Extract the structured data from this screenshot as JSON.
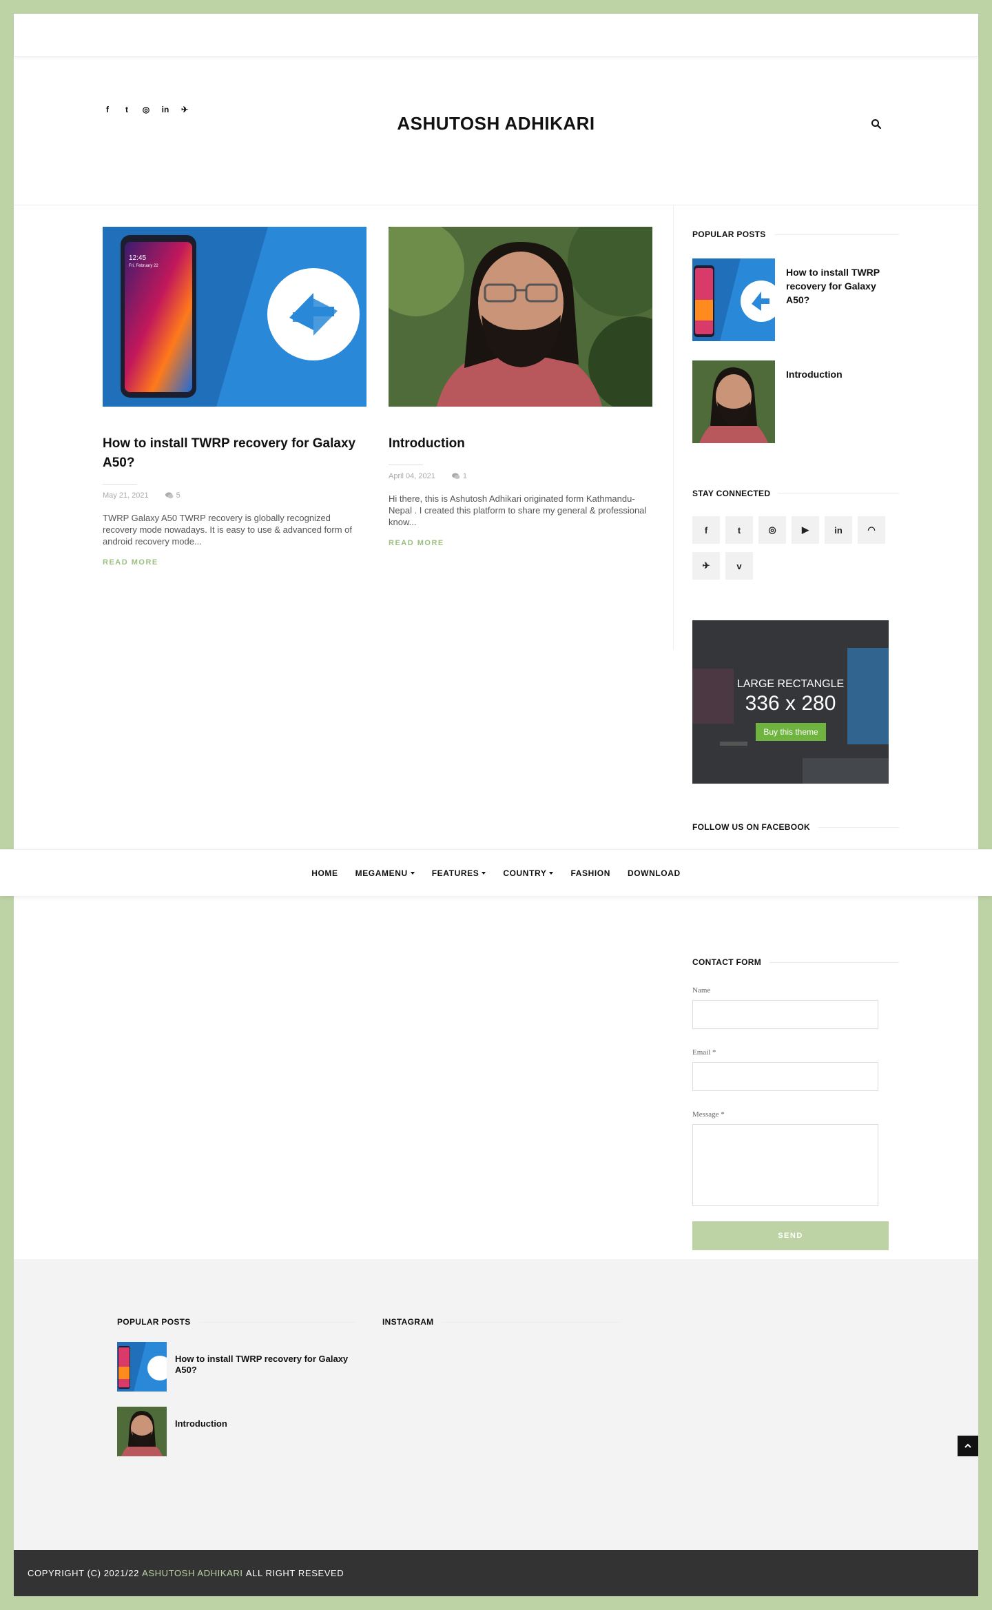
{
  "site": {
    "title": "ASHUTOSH ADHIKARI"
  },
  "header": {
    "social_icons": [
      "facebook-icon",
      "twitter-icon",
      "instagram-icon",
      "linkedin-icon",
      "telegram-icon"
    ],
    "social_glyphs": [
      "f",
      "t",
      "◎",
      "in",
      "✈"
    ]
  },
  "posts": [
    {
      "title": "How to install TWRP recovery for Galaxy A50?",
      "date": "May 21, 2021",
      "comments": "5",
      "excerpt": " TWRP Galaxy A50 TWRP recovery is globally recognized recovery mode nowadays. It is easy to use & advanced form of android recovery mode...",
      "read_more": "READ MORE",
      "image": "twrp-galaxy-a50-image",
      "phone_time": "12:45",
      "phone_date": "Fri, February 22"
    },
    {
      "title": "Introduction",
      "date": "April 04, 2021",
      "comments": "1",
      "excerpt": "  Hi there, this is Ashutosh Adhikari originated form Kathmandu-Nepal . I created this platform to share my general & professional know...",
      "read_more": "READ MORE",
      "image": "author-portrait-image"
    }
  ],
  "sidebar": {
    "popular_title": "POPULAR POSTS",
    "popular": [
      "How to install TWRP recovery for Galaxy A50?",
      "Introduction"
    ],
    "stay_connected_title": "STAY CONNECTED",
    "stay_icons": [
      "facebook-icon",
      "twitter-icon",
      "instagram-icon",
      "youtube-icon",
      "linkedin-icon",
      "rss-icon",
      "telegram-icon",
      "vimeo-icon"
    ],
    "stay_glyphs": [
      "f",
      "t",
      "◎",
      "▶",
      "in",
      "◠",
      "✈",
      "v"
    ],
    "ad": {
      "line1": "LARGE RECTANGLE",
      "line2": "336 x 280",
      "button": "Buy this theme"
    },
    "facebook_title": "FOLLOW US ON FACEBOOK",
    "contact_title": "CONTACT FORM",
    "form": {
      "name": "Name",
      "email": "Email *",
      "message": "Message *",
      "send": "SEND"
    }
  },
  "nav": {
    "home": "HOME",
    "megamenu": "MEGAMENU",
    "features": "FEATURES",
    "country": "COUNTRY",
    "fashion": "FASHION",
    "download": "DOWNLOAD"
  },
  "footer": {
    "popular_title": "POPULAR POSTS",
    "popular": [
      "How to install TWRP recovery for Galaxy A50?",
      "Introduction"
    ],
    "instagram_title": "INSTAGRAM",
    "copyright": "COPYRIGHT (C) 2021/22",
    "brand": "ASHUTOSH ADHIKARI",
    "rights": "ALL RIGHT RESEVED"
  },
  "colors": {
    "accent": "#bdd3a6",
    "dark_footer": "#333333",
    "twrp_blue": "#2a88d8"
  }
}
